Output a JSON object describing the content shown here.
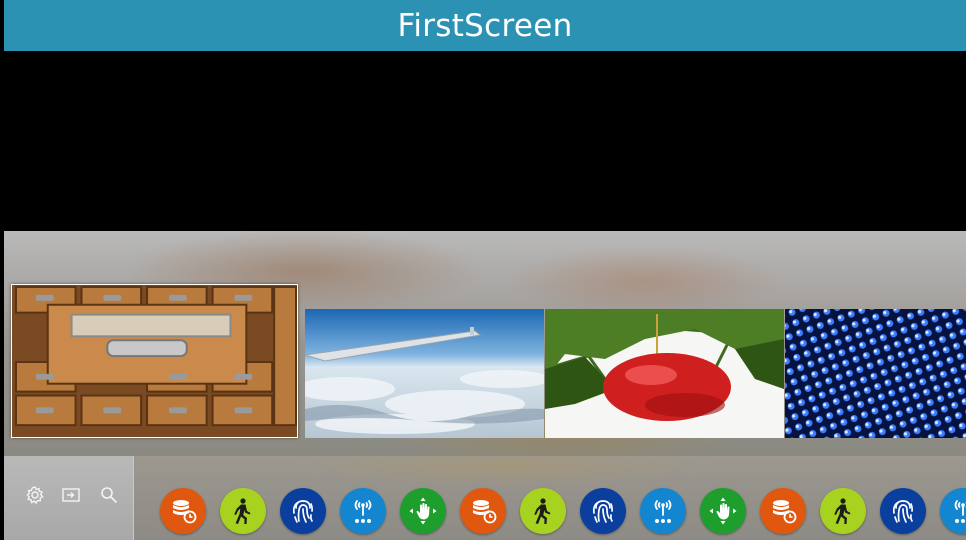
{
  "screen": {
    "title": "FirstScreen"
  },
  "colors": {
    "title_bar": "#2b92b4",
    "db_app": "#e0580f",
    "walker_app": "#a7d21f",
    "fingerprint_app": "#0a3f9e",
    "antenna_app": "#1486d0",
    "gesture_app": "#1e9e2c"
  },
  "thumbnails": [
    {
      "icon": "card-catalog-drawers-image",
      "selected": true
    },
    {
      "icon": "airplane-wing-snow-image",
      "selected": false
    },
    {
      "icon": "red-ornament-pine-image",
      "selected": false
    },
    {
      "icon": "blue-perforated-metal-image",
      "selected": false
    }
  ],
  "toolbar": {
    "items": [
      {
        "icon": "gear-icon"
      },
      {
        "icon": "input-source-icon"
      },
      {
        "icon": "search-icon"
      }
    ]
  },
  "apps": [
    {
      "icon": "database-sync-icon",
      "color": "#e0580f"
    },
    {
      "icon": "walking-person-icon",
      "color": "#a7d21f"
    },
    {
      "icon": "fingerprint-icon",
      "color": "#0a3f9e"
    },
    {
      "icon": "antenna-signal-icon",
      "color": "#1486d0"
    },
    {
      "icon": "hand-gesture-icon",
      "color": "#1e9e2c"
    },
    {
      "icon": "database-sync-icon",
      "color": "#e0580f"
    },
    {
      "icon": "walking-person-icon",
      "color": "#a7d21f"
    },
    {
      "icon": "fingerprint-icon",
      "color": "#0a3f9e"
    },
    {
      "icon": "antenna-signal-icon",
      "color": "#1486d0"
    },
    {
      "icon": "hand-gesture-icon",
      "color": "#1e9e2c"
    },
    {
      "icon": "database-sync-icon",
      "color": "#e0580f"
    },
    {
      "icon": "walking-person-icon",
      "color": "#a7d21f"
    },
    {
      "icon": "fingerprint-icon",
      "color": "#0a3f9e"
    },
    {
      "icon": "antenna-signal-icon",
      "color": "#1486d0"
    }
  ]
}
